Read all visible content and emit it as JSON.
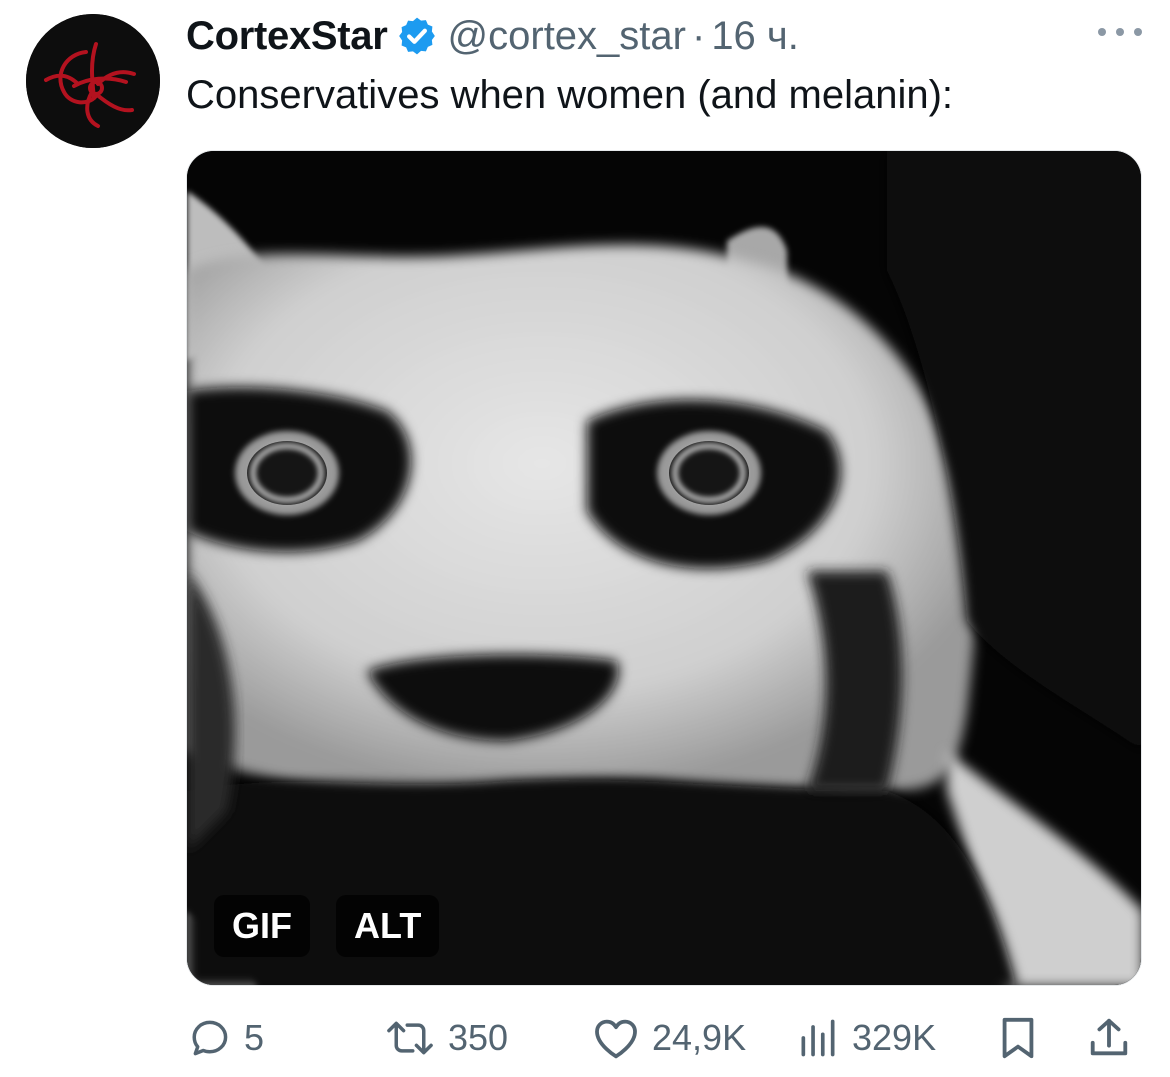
{
  "tweet": {
    "display_name": "CortexStar",
    "handle": "@cortex_star",
    "separator": "·",
    "time": "16 ч.",
    "text": "Conservatives when women (and melanin):",
    "verified_color": "#1d9bf0",
    "avatar_icon": "red-swirl-logo-icon",
    "more_icon": "more-dots-icon"
  },
  "media": {
    "description_icon": "cat-face-gif-image",
    "badges": {
      "gif": "GIF",
      "alt": "ALT"
    }
  },
  "actions": {
    "reply": {
      "icon": "reply-icon",
      "count": "5"
    },
    "retweet": {
      "icon": "retweet-icon",
      "count": "350"
    },
    "like": {
      "icon": "heart-icon",
      "count": "24,9K"
    },
    "views": {
      "icon": "views-chart-icon",
      "count": "329K"
    },
    "bookmark": {
      "icon": "bookmark-icon"
    },
    "share": {
      "icon": "share-icon"
    }
  },
  "colors": {
    "text": "#0f1419",
    "secondary": "#536471",
    "accent": "#1d9bf0"
  }
}
